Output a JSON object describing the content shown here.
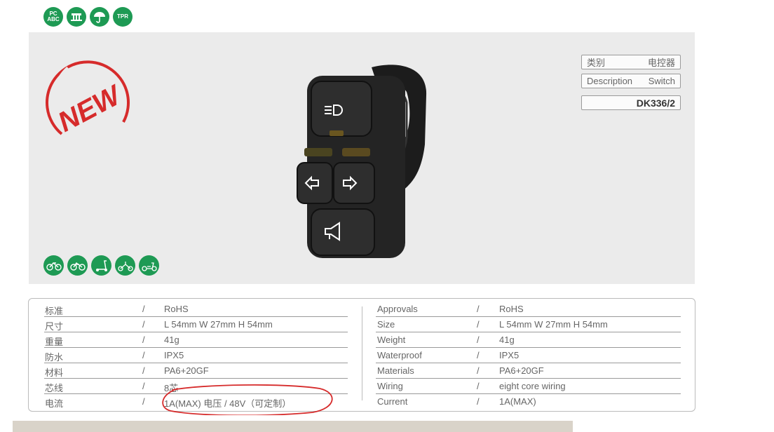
{
  "material_icons": [
    {
      "name": "pc-abc-icon",
      "label_top": "PC",
      "label_bottom": "ABC"
    },
    {
      "name": "pa-icon",
      "label_top": "",
      "label_bottom": ""
    },
    {
      "name": "umbrella-icon",
      "label_top": "",
      "label_bottom": ""
    },
    {
      "name": "tpr-icon",
      "label_top": "TPR",
      "label_bottom": ""
    }
  ],
  "badge": {
    "text": "NEW"
  },
  "spec": {
    "category_label": "类别",
    "category_value": "电控器",
    "description_label": "Description",
    "description_value": "Switch",
    "model": "DK336/2"
  },
  "usage_icons": [
    "bicycle-icon",
    "ebike-icon",
    "scooter-icon",
    "tricycle-icon",
    "moped-icon"
  ],
  "table_cn": [
    {
      "label": "标准",
      "sep": "/",
      "value": "RoHS"
    },
    {
      "label": "尺寸",
      "sep": "/",
      "value": "L 54mm W 27mm H 54mm"
    },
    {
      "label": "重量",
      "sep": "/",
      "value": "41g"
    },
    {
      "label": "防水",
      "sep": "/",
      "value": "IPX5"
    },
    {
      "label": "材料",
      "sep": "/",
      "value": "PA6+20GF"
    },
    {
      "label": "芯线",
      "sep": "/",
      "value": "8芯"
    },
    {
      "label": "电流",
      "sep": "/",
      "value": "1A(MAX)      电压      /      48V（可定制）"
    }
  ],
  "table_en": [
    {
      "label": "Approvals",
      "sep": "/",
      "value": "RoHS"
    },
    {
      "label": "Size",
      "sep": "/",
      "value": "L 54mm W 27mm H 54mm"
    },
    {
      "label": "Weight",
      "sep": "/",
      "value": "41g"
    },
    {
      "label": "Waterproof",
      "sep": "/",
      "value": "IPX5"
    },
    {
      "label": "Materials",
      "sep": "/",
      "value": "PA6+20GF"
    },
    {
      "label": "Wiring",
      "sep": "/",
      "value": "eight core wiring"
    },
    {
      "label": "Current",
      "sep": "/",
      "value": "1A(MAX)"
    }
  ]
}
